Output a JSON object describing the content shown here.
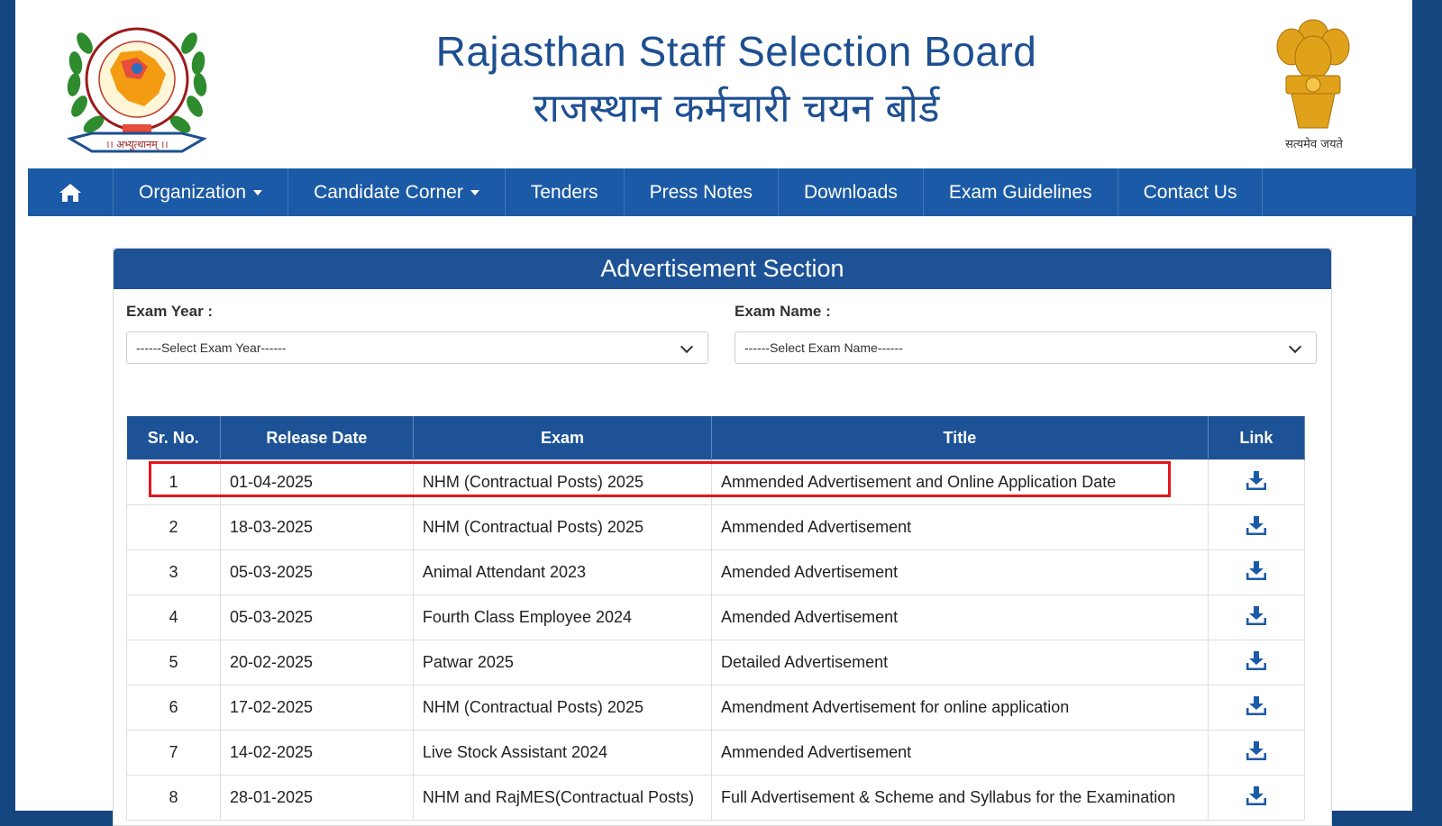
{
  "header": {
    "title_en": "Rajasthan Staff Selection Board",
    "title_hi": "राजस्थान कर्मचारी चयन बोर्ड",
    "emblem_motto": "सत्यमेव जयते",
    "logo_left_motto": "।। अभ्युत्थानम् ।।"
  },
  "nav": {
    "home_icon": "home-icon",
    "items": [
      {
        "label": "Organization",
        "dropdown": true
      },
      {
        "label": "Candidate Corner",
        "dropdown": true
      },
      {
        "label": "Tenders"
      },
      {
        "label": "Press Notes"
      },
      {
        "label": "Downloads"
      },
      {
        "label": "Exam Guidelines"
      },
      {
        "label": "Contact Us"
      }
    ]
  },
  "section": {
    "title": "Advertisement Section",
    "exam_year_label": "Exam Year :",
    "exam_year_value": "------Select Exam Year------",
    "exam_name_label": "Exam Name :",
    "exam_name_value": "------Select Exam Name------"
  },
  "table": {
    "columns": [
      "Sr. No.",
      "Release Date",
      "Exam",
      "Title",
      "Link"
    ],
    "rows": [
      {
        "sr": "1",
        "date": "01-04-2025",
        "exam": "NHM (Contractual Posts) 2025",
        "title": "Ammended Advertisement and Online Application Date"
      },
      {
        "sr": "2",
        "date": "18-03-2025",
        "exam": "NHM (Contractual Posts) 2025",
        "title": "Ammended Advertisement"
      },
      {
        "sr": "3",
        "date": "05-03-2025",
        "exam": "Animal Attendant 2023",
        "title": "Amended Advertisement"
      },
      {
        "sr": "4",
        "date": "05-03-2025",
        "exam": "Fourth Class Employee 2024",
        "title": "Amended Advertisement"
      },
      {
        "sr": "5",
        "date": "20-02-2025",
        "exam": "Patwar 2025",
        "title": "Detailed Advertisement"
      },
      {
        "sr": "6",
        "date": "17-02-2025",
        "exam": "NHM (Contractual Posts) 2025",
        "title": "Amendment Advertisement for online application"
      },
      {
        "sr": "7",
        "date": "14-02-2025",
        "exam": "Live Stock Assistant 2024",
        "title": "Ammended Advertisement"
      },
      {
        "sr": "8",
        "date": "28-01-2025",
        "exam": "NHM and RajMES(Contractual Posts)",
        "title": "Full Advertisement & Scheme and Syllabus for the Examination"
      }
    ],
    "link_icon": "download-icon"
  },
  "colors": {
    "brand_blue": "#1b5aa6",
    "header_title": "#1d4f91",
    "highlight": "#e5161b",
    "outer_border": "#16467f"
  }
}
